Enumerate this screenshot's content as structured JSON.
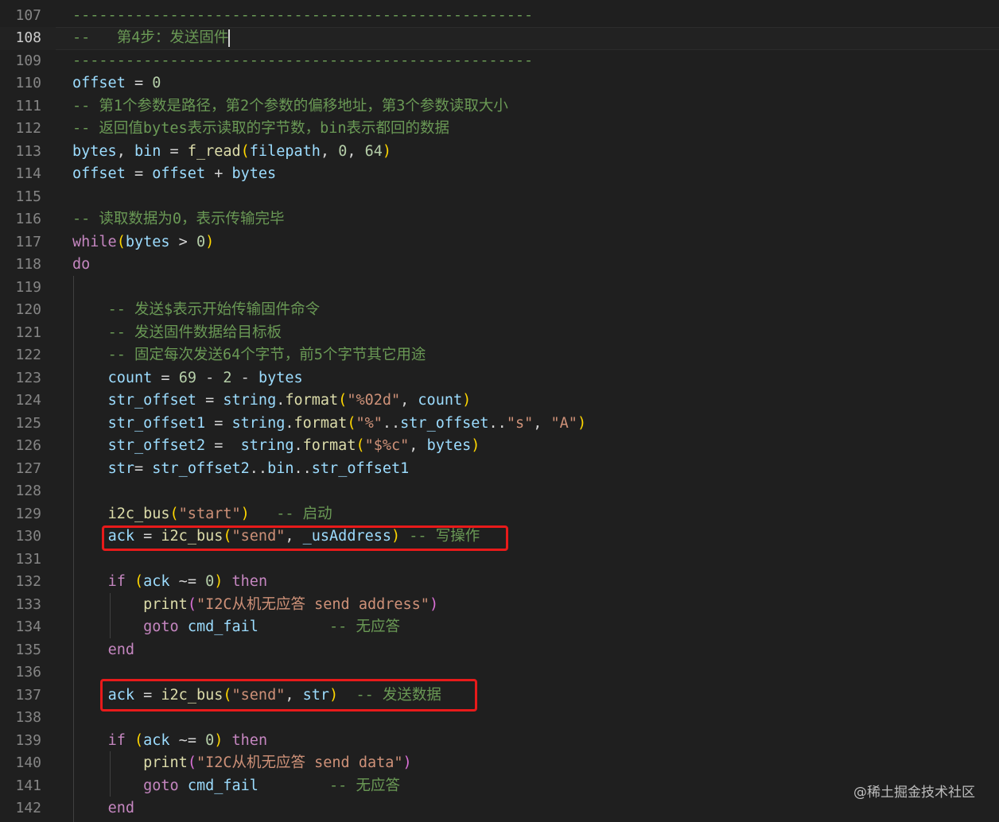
{
  "editor": {
    "current_line": 108,
    "watermark": "@稀土掘金技术社区",
    "lines": [
      {
        "no": "107",
        "tokens": [
          [
            "c",
            "----------------------------------------------------"
          ]
        ]
      },
      {
        "no": "108",
        "tokens": [
          [
            "c",
            "--   第4步：发送固件"
          ]
        ]
      },
      {
        "no": "109",
        "tokens": [
          [
            "c",
            "----------------------------------------------------"
          ]
        ]
      },
      {
        "no": "110",
        "tokens": [
          [
            "v",
            "offset"
          ],
          [
            "op",
            " = "
          ],
          [
            "n",
            "0"
          ]
        ]
      },
      {
        "no": "111",
        "tokens": [
          [
            "c",
            "-- 第1个参数是路径，第2个参数的偏移地址，第3个参数读取大小"
          ]
        ]
      },
      {
        "no": "112",
        "tokens": [
          [
            "c",
            "-- 返回值bytes表示读取的字节数，bin表示都回的数据"
          ]
        ]
      },
      {
        "no": "113",
        "tokens": [
          [
            "v",
            "bytes"
          ],
          [
            "op",
            ", "
          ],
          [
            "v",
            "bin"
          ],
          [
            "op",
            " = "
          ],
          [
            "f",
            "f_read"
          ],
          [
            "b",
            "("
          ],
          [
            "v",
            "filepath"
          ],
          [
            "op",
            ", "
          ],
          [
            "n",
            "0"
          ],
          [
            "op",
            ", "
          ],
          [
            "n",
            "64"
          ],
          [
            "b",
            ")"
          ]
        ]
      },
      {
        "no": "114",
        "tokens": [
          [
            "v",
            "offset"
          ],
          [
            "op",
            " = "
          ],
          [
            "v",
            "offset"
          ],
          [
            "op",
            " + "
          ],
          [
            "v",
            "bytes"
          ]
        ]
      },
      {
        "no": "115",
        "tokens": []
      },
      {
        "no": "116",
        "tokens": [
          [
            "c",
            "-- 读取数据为0，表示传输完毕"
          ]
        ]
      },
      {
        "no": "117",
        "tokens": [
          [
            "k",
            "while"
          ],
          [
            "b",
            "("
          ],
          [
            "v",
            "bytes"
          ],
          [
            "op",
            " > "
          ],
          [
            "n",
            "0"
          ],
          [
            "b",
            ")"
          ]
        ]
      },
      {
        "no": "118",
        "tokens": [
          [
            "k",
            "do"
          ]
        ]
      },
      {
        "no": "119",
        "tokens": []
      },
      {
        "no": "120",
        "tokens": [
          [
            "op",
            "    "
          ],
          [
            "c",
            "-- 发送$表示开始传输固件命令"
          ]
        ]
      },
      {
        "no": "121",
        "tokens": [
          [
            "op",
            "    "
          ],
          [
            "c",
            "-- 发送固件数据给目标板"
          ]
        ]
      },
      {
        "no": "122",
        "tokens": [
          [
            "op",
            "    "
          ],
          [
            "c",
            "-- 固定每次发送64个字节，前5个字节其它用途"
          ]
        ]
      },
      {
        "no": "123",
        "tokens": [
          [
            "op",
            "    "
          ],
          [
            "v",
            "count"
          ],
          [
            "op",
            " = "
          ],
          [
            "n",
            "69"
          ],
          [
            "op",
            " - "
          ],
          [
            "n",
            "2"
          ],
          [
            "op",
            " - "
          ],
          [
            "v",
            "bytes"
          ]
        ]
      },
      {
        "no": "124",
        "tokens": [
          [
            "op",
            "    "
          ],
          [
            "v",
            "str_offset"
          ],
          [
            "op",
            " = "
          ],
          [
            "v",
            "string"
          ],
          [
            "op",
            "."
          ],
          [
            "f",
            "format"
          ],
          [
            "b",
            "("
          ],
          [
            "s",
            "\"%02d\""
          ],
          [
            "op",
            ", "
          ],
          [
            "v",
            "count"
          ],
          [
            "b",
            ")"
          ]
        ]
      },
      {
        "no": "125",
        "tokens": [
          [
            "op",
            "    "
          ],
          [
            "v",
            "str_offset1"
          ],
          [
            "op",
            " = "
          ],
          [
            "v",
            "string"
          ],
          [
            "op",
            "."
          ],
          [
            "f",
            "format"
          ],
          [
            "b",
            "("
          ],
          [
            "s",
            "\"%\""
          ],
          [
            "op",
            ".."
          ],
          [
            "v",
            "str_offset"
          ],
          [
            "op",
            ".."
          ],
          [
            "s",
            "\"s\""
          ],
          [
            "op",
            ", "
          ],
          [
            "s",
            "\"A\""
          ],
          [
            "b",
            ")"
          ]
        ]
      },
      {
        "no": "126",
        "tokens": [
          [
            "op",
            "    "
          ],
          [
            "v",
            "str_offset2"
          ],
          [
            "op",
            " =  "
          ],
          [
            "v",
            "string"
          ],
          [
            "op",
            "."
          ],
          [
            "f",
            "format"
          ],
          [
            "b",
            "("
          ],
          [
            "s",
            "\"$%c\""
          ],
          [
            "op",
            ", "
          ],
          [
            "v",
            "bytes"
          ],
          [
            "b",
            ")"
          ]
        ]
      },
      {
        "no": "127",
        "tokens": [
          [
            "op",
            "    "
          ],
          [
            "v",
            "str"
          ],
          [
            "op",
            "= "
          ],
          [
            "v",
            "str_offset2"
          ],
          [
            "op",
            ".."
          ],
          [
            "v",
            "bin"
          ],
          [
            "op",
            ".."
          ],
          [
            "v",
            "str_offset1"
          ]
        ]
      },
      {
        "no": "128",
        "tokens": []
      },
      {
        "no": "129",
        "tokens": [
          [
            "op",
            "    "
          ],
          [
            "f",
            "i2c_bus"
          ],
          [
            "b",
            "("
          ],
          [
            "s",
            "\"start\""
          ],
          [
            "b",
            ")"
          ],
          [
            "op",
            "   "
          ],
          [
            "c",
            "-- 启动"
          ]
        ]
      },
      {
        "no": "130",
        "tokens": [
          [
            "op",
            "    "
          ],
          [
            "v",
            "ack"
          ],
          [
            "op",
            " = "
          ],
          [
            "f",
            "i2c_bus"
          ],
          [
            "b",
            "("
          ],
          [
            "s",
            "\"send\""
          ],
          [
            "op",
            ", "
          ],
          [
            "v",
            "_usAddress"
          ],
          [
            "b",
            ")"
          ],
          [
            "op",
            " "
          ],
          [
            "c",
            "-- 写操作"
          ]
        ]
      },
      {
        "no": "131",
        "tokens": []
      },
      {
        "no": "132",
        "tokens": [
          [
            "op",
            "    "
          ],
          [
            "k",
            "if"
          ],
          [
            "op",
            " "
          ],
          [
            "b",
            "("
          ],
          [
            "v",
            "ack"
          ],
          [
            "op",
            " ~= "
          ],
          [
            "n",
            "0"
          ],
          [
            "b",
            ")"
          ],
          [
            "op",
            " "
          ],
          [
            "k",
            "then"
          ]
        ]
      },
      {
        "no": "133",
        "tokens": [
          [
            "op",
            "        "
          ],
          [
            "f",
            "print"
          ],
          [
            "b2",
            "("
          ],
          [
            "s",
            "\"I2C从机无应答 send address\""
          ],
          [
            "b2",
            ")"
          ]
        ]
      },
      {
        "no": "134",
        "tokens": [
          [
            "op",
            "        "
          ],
          [
            "k",
            "goto"
          ],
          [
            "op",
            " "
          ],
          [
            "v",
            "cmd_fail"
          ],
          [
            "op",
            "        "
          ],
          [
            "c",
            "-- 无应答"
          ]
        ]
      },
      {
        "no": "135",
        "tokens": [
          [
            "op",
            "    "
          ],
          [
            "k",
            "end"
          ]
        ]
      },
      {
        "no": "136",
        "tokens": []
      },
      {
        "no": "137",
        "tokens": [
          [
            "op",
            "    "
          ],
          [
            "v",
            "ack"
          ],
          [
            "op",
            " = "
          ],
          [
            "f",
            "i2c_bus"
          ],
          [
            "b",
            "("
          ],
          [
            "s",
            "\"send\""
          ],
          [
            "op",
            ", "
          ],
          [
            "v",
            "str"
          ],
          [
            "b",
            ")"
          ],
          [
            "op",
            "  "
          ],
          [
            "c",
            "-- 发送数据"
          ]
        ]
      },
      {
        "no": "138",
        "tokens": []
      },
      {
        "no": "139",
        "tokens": [
          [
            "op",
            "    "
          ],
          [
            "k",
            "if"
          ],
          [
            "op",
            " "
          ],
          [
            "b",
            "("
          ],
          [
            "v",
            "ack"
          ],
          [
            "op",
            " ~= "
          ],
          [
            "n",
            "0"
          ],
          [
            "b",
            ")"
          ],
          [
            "op",
            " "
          ],
          [
            "k",
            "then"
          ]
        ]
      },
      {
        "no": "140",
        "tokens": [
          [
            "op",
            "        "
          ],
          [
            "f",
            "print"
          ],
          [
            "b2",
            "("
          ],
          [
            "s",
            "\"I2C从机无应答 send data\""
          ],
          [
            "b2",
            ")"
          ]
        ]
      },
      {
        "no": "141",
        "tokens": [
          [
            "op",
            "        "
          ],
          [
            "k",
            "goto"
          ],
          [
            "op",
            " "
          ],
          [
            "v",
            "cmd_fail"
          ],
          [
            "op",
            "        "
          ],
          [
            "c",
            "-- 无应答"
          ]
        ]
      },
      {
        "no": "142",
        "tokens": [
          [
            "op",
            "    "
          ],
          [
            "k",
            "end"
          ]
        ]
      }
    ]
  }
}
